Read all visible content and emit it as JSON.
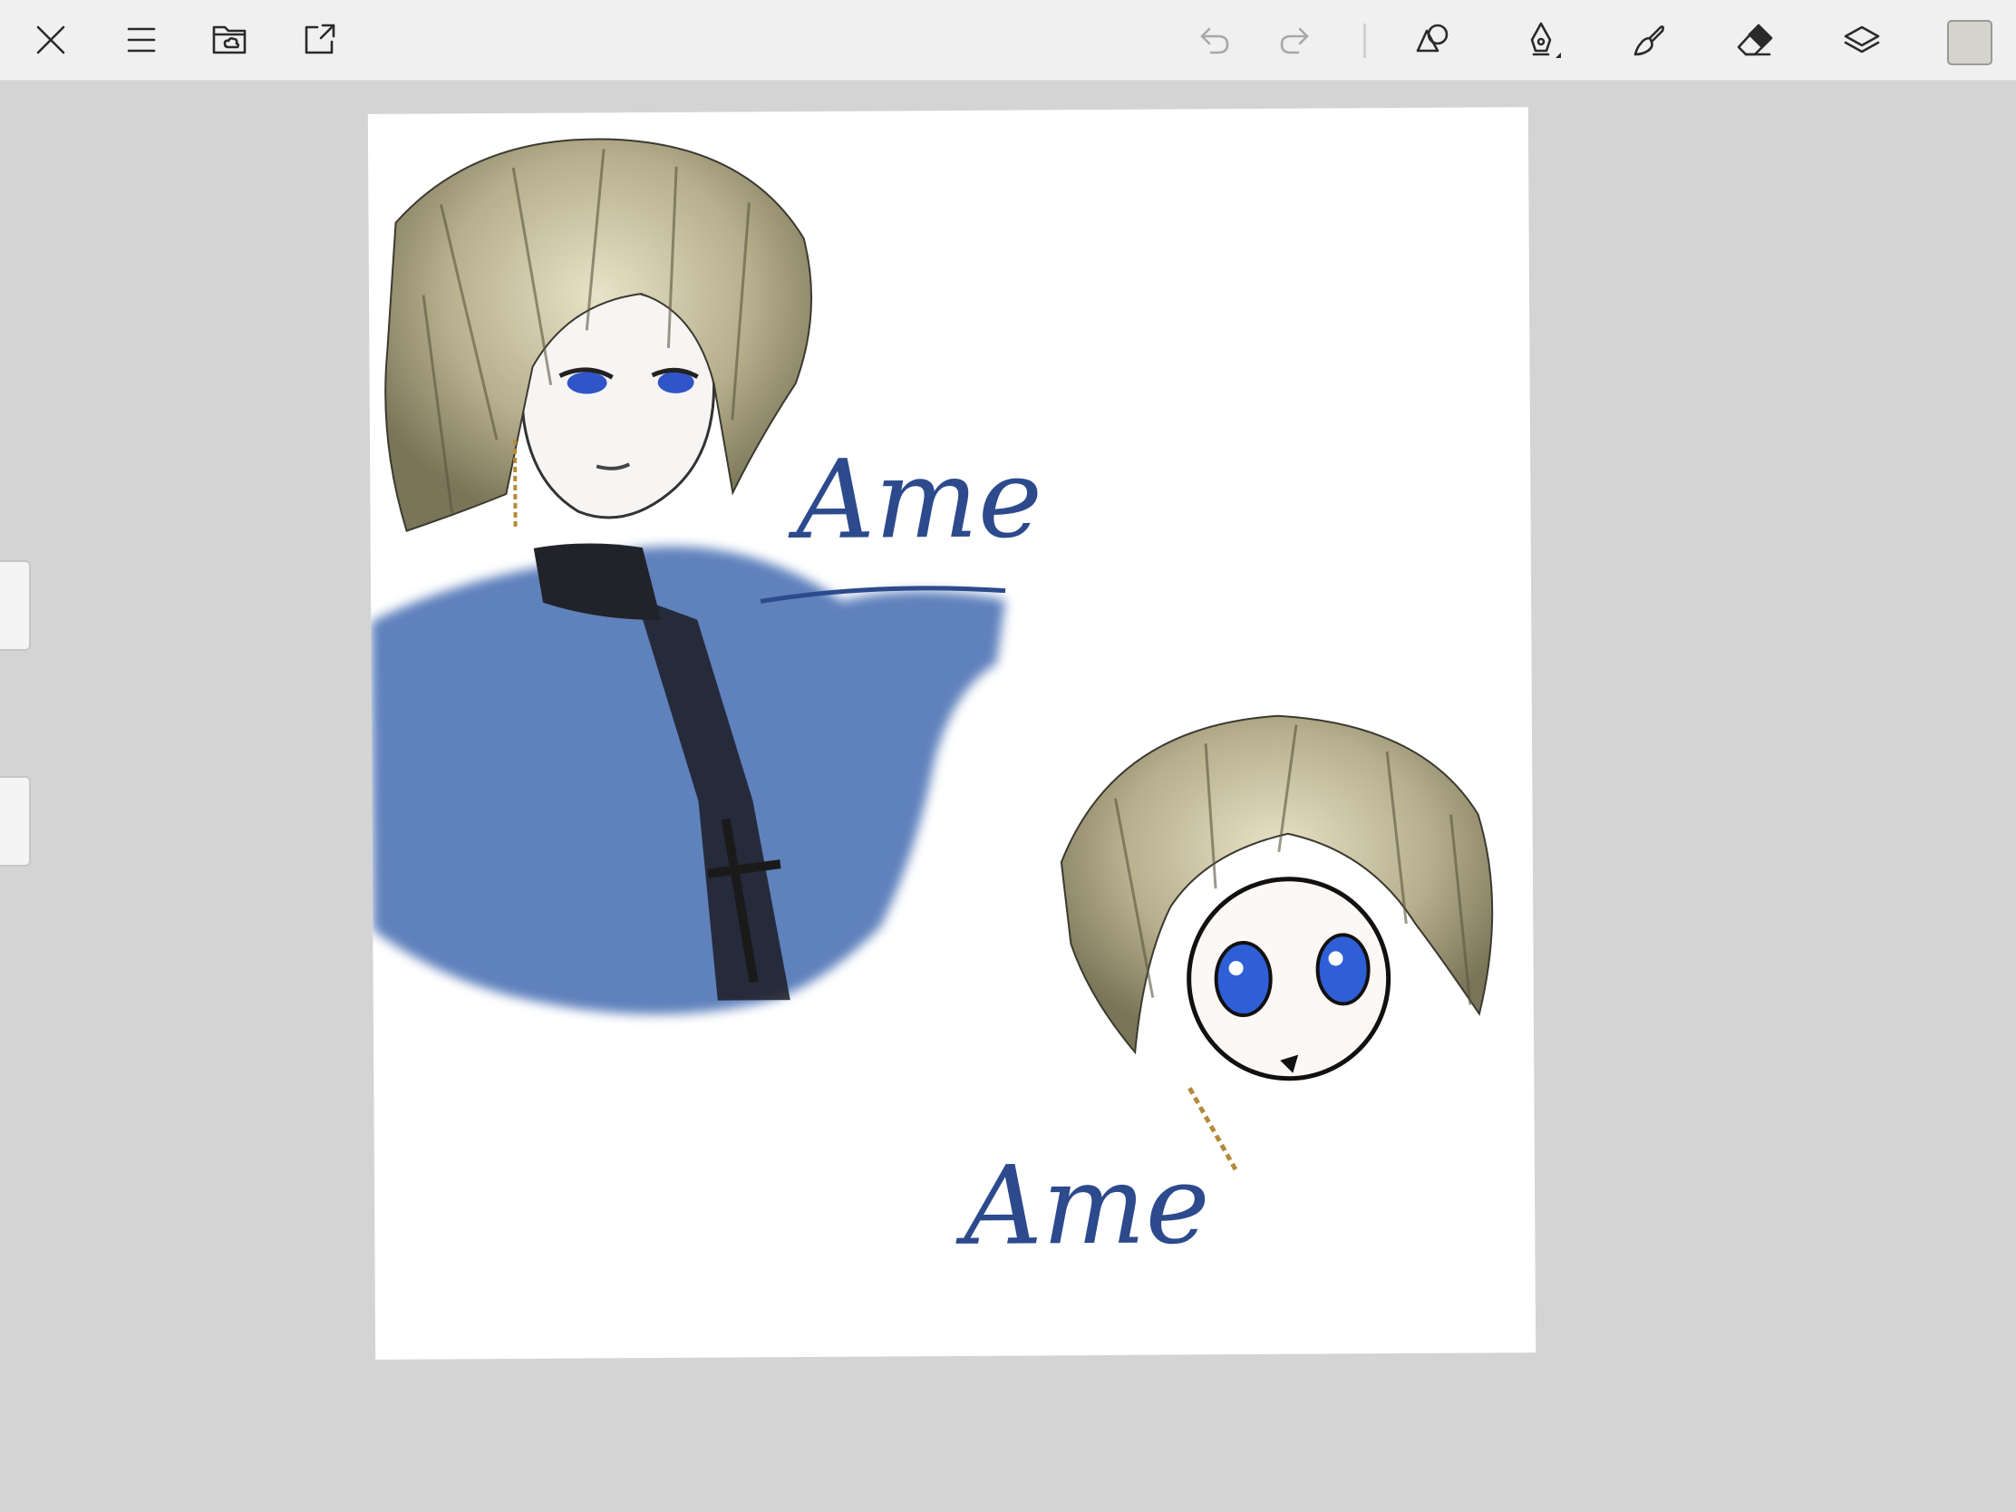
{
  "app": {
    "toolbar": {
      "close": "close-icon",
      "menu": "menu-icon",
      "gallery": "gallery-folder-icon",
      "share": "share-icon",
      "undo": "undo-icon",
      "redo": "redo-icon",
      "shapes": "shapes-icon",
      "pen": "pen-nib-icon",
      "brush": "brush-icon",
      "eraser": "eraser-icon",
      "layers": "layers-icon",
      "color": "#d4d4cc"
    },
    "colors": {
      "toolbar_bg": "#f0f0f0",
      "workspace_bg": "#d4d4d4",
      "canvas_bg": "#ffffff"
    }
  },
  "canvas": {
    "signature_1": "Ame",
    "signature_2": "Ame"
  }
}
